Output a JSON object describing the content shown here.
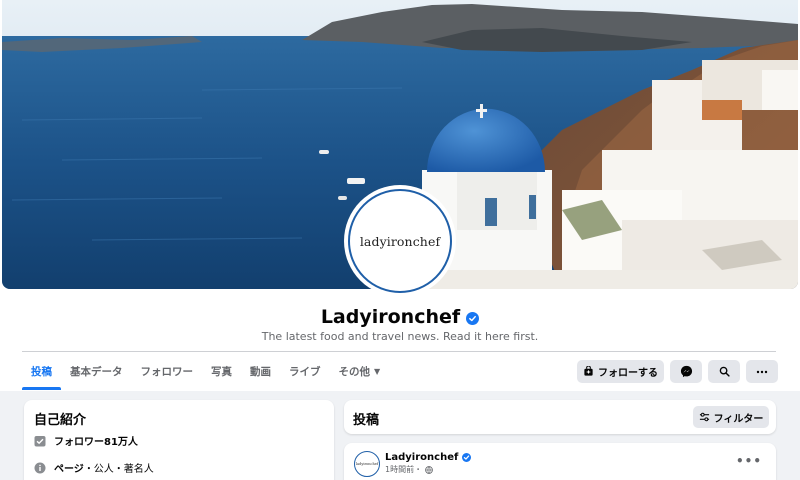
{
  "profile": {
    "avatar_logo_text": "ladyironchef",
    "name": "Ladyironchef",
    "tagline": "The latest food and travel news. Read it here first."
  },
  "tabs": [
    {
      "label": "投稿",
      "active": true
    },
    {
      "label": "基本データ"
    },
    {
      "label": "フォロワー"
    },
    {
      "label": "写真"
    },
    {
      "label": "動画"
    },
    {
      "label": "ライブ"
    },
    {
      "label": "その他"
    }
  ],
  "actions": {
    "follow_label": "フォローする",
    "icons": [
      "messenger-icon",
      "search-icon",
      "more-icon"
    ]
  },
  "intro": {
    "title": "自己紹介",
    "followers": "フォロワー81万人",
    "page_type_prefix": "ページ",
    "page_type_suffix": "・公人・著名人"
  },
  "posts_section": {
    "title": "投稿",
    "filter_label": "フィルター"
  },
  "post": {
    "author": "Ladyironchef",
    "time": "1時間前・",
    "more": "•••"
  },
  "colors": {
    "accent": "#1877f2",
    "background": "#f0f2f5",
    "button_bg": "#e4e6eb",
    "secondary_text": "#65676b"
  }
}
